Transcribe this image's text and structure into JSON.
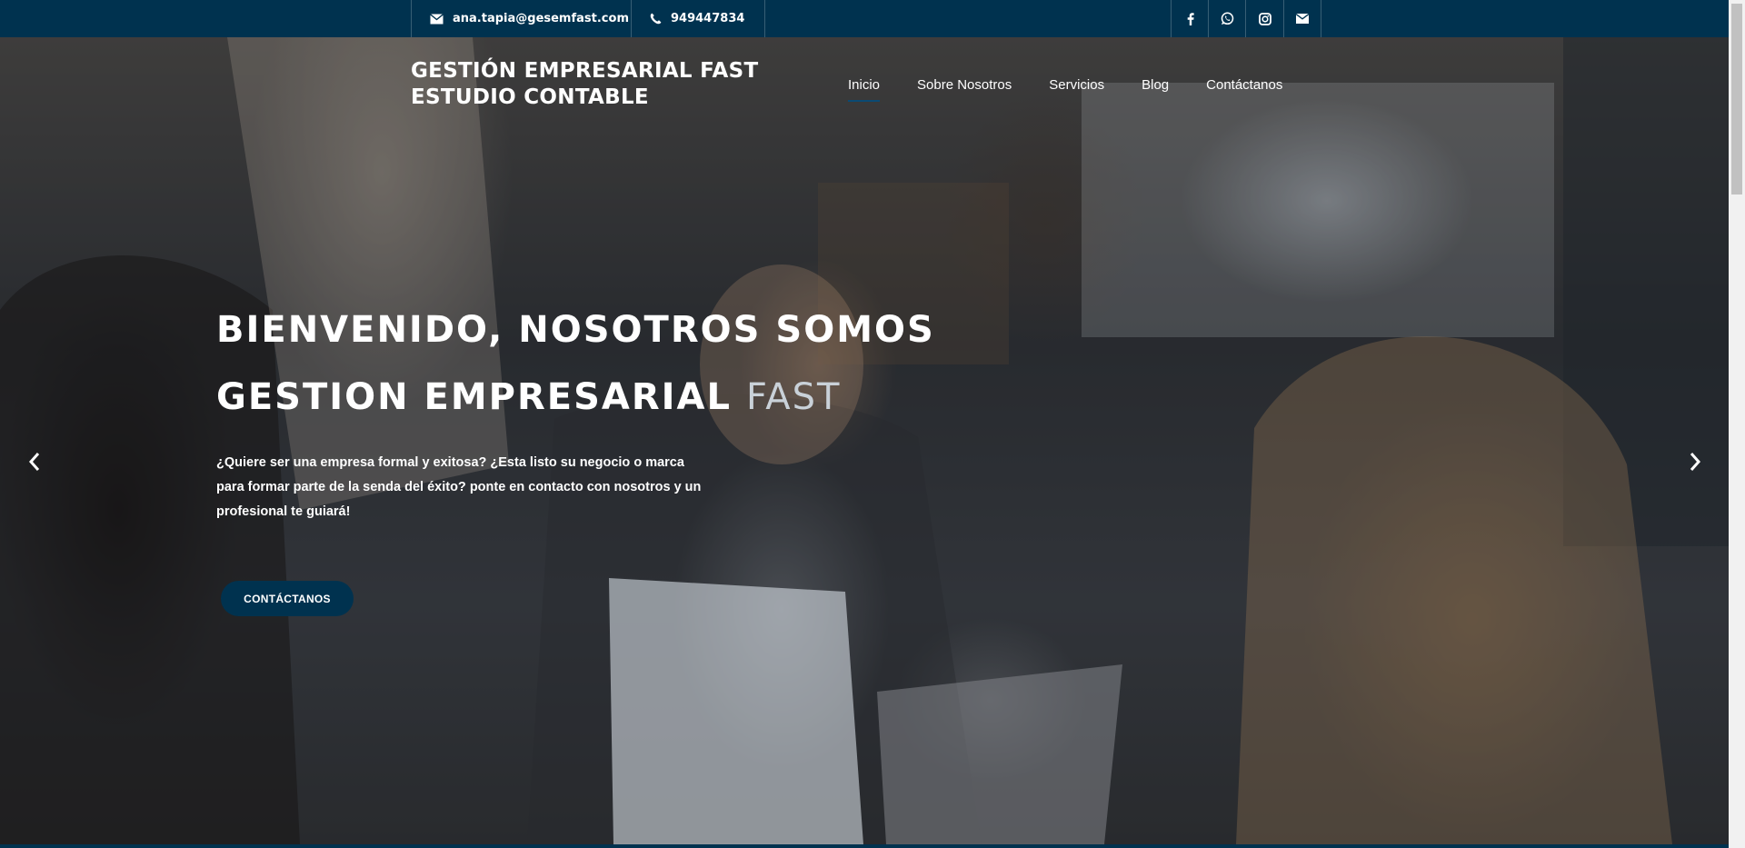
{
  "topbar": {
    "email": "ana.tapia@gesemfast.com",
    "phone": "949447834",
    "social_icons": [
      "facebook-icon",
      "whatsapp-icon",
      "instagram-icon",
      "envelope-icon"
    ]
  },
  "brand": {
    "line1": "GESTIÓN EMPRESARIAL FAST",
    "line2": "ESTUDIO CONTABLE"
  },
  "nav": {
    "items": [
      {
        "label": "Inicio"
      },
      {
        "label": "Sobre Nosotros"
      },
      {
        "label": "Servicios"
      },
      {
        "label": "Blog"
      },
      {
        "label": "Contáctanos"
      }
    ]
  },
  "hero": {
    "headline_line1": "BIENVENIDO, NOSOTROS SOMOS",
    "headline_line2_main": "GESTION EMPRESARIAL",
    "headline_line2_accent": "FAST",
    "lede": "¿Quiere ser una empresa formal y exitosa? ¿Esta listo su negocio o marca para formar parte de la senda del éxito? ponte en contacto con nosotros y un profesional te guiará!",
    "cta_label": "CONTÁCTANOS"
  },
  "colors": {
    "primary": "#00324f",
    "accent_text": "#c9d1d8"
  }
}
